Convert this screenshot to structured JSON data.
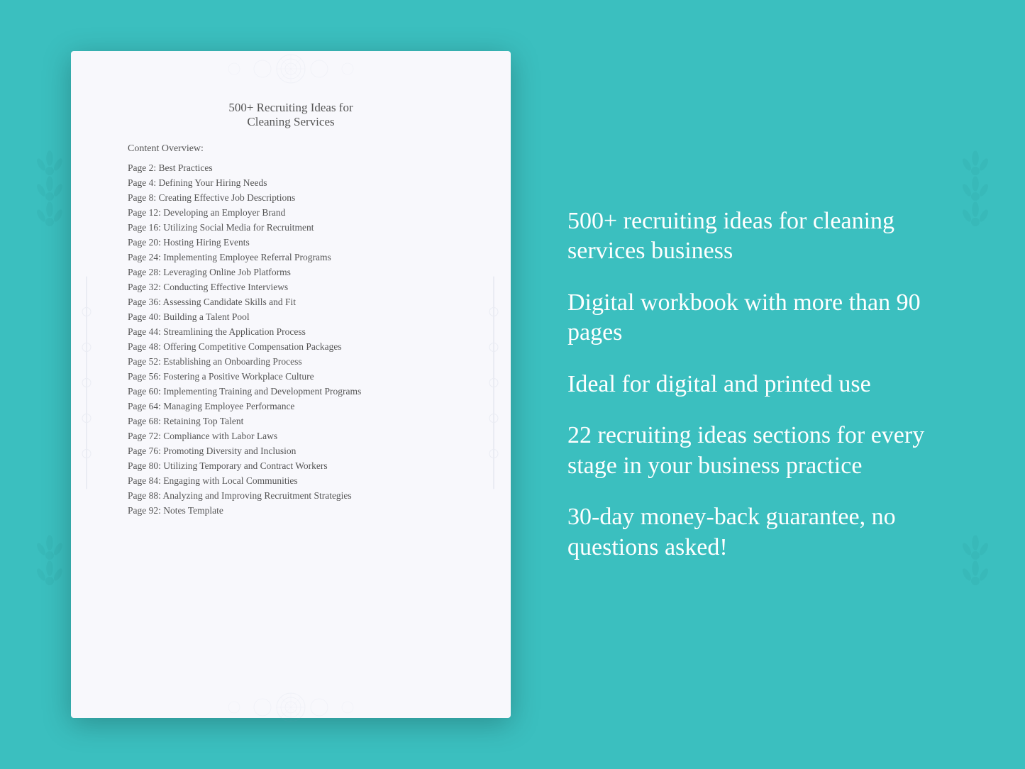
{
  "background": {
    "color": "#3bbfbf"
  },
  "document": {
    "title_line1": "500+ Recruiting Ideas for",
    "title_line2": "Cleaning Services",
    "content_overview_label": "Content Overview:",
    "toc_items": [
      {
        "page": "Page  2:",
        "title": "Best Practices"
      },
      {
        "page": "Page  4:",
        "title": "Defining Your Hiring Needs"
      },
      {
        "page": "Page  8:",
        "title": "Creating Effective Job Descriptions"
      },
      {
        "page": "Page 12:",
        "title": "Developing an Employer Brand"
      },
      {
        "page": "Page 16:",
        "title": "Utilizing Social Media for Recruitment"
      },
      {
        "page": "Page 20:",
        "title": "Hosting Hiring Events"
      },
      {
        "page": "Page 24:",
        "title": "Implementing Employee Referral Programs"
      },
      {
        "page": "Page 28:",
        "title": "Leveraging Online Job Platforms"
      },
      {
        "page": "Page 32:",
        "title": "Conducting Effective Interviews"
      },
      {
        "page": "Page 36:",
        "title": "Assessing Candidate Skills and Fit"
      },
      {
        "page": "Page 40:",
        "title": "Building a Talent Pool"
      },
      {
        "page": "Page 44:",
        "title": "Streamlining the Application Process"
      },
      {
        "page": "Page 48:",
        "title": "Offering Competitive Compensation Packages"
      },
      {
        "page": "Page 52:",
        "title": "Establishing an Onboarding Process"
      },
      {
        "page": "Page 56:",
        "title": "Fostering a Positive Workplace Culture"
      },
      {
        "page": "Page 60:",
        "title": "Implementing Training and Development Programs"
      },
      {
        "page": "Page 64:",
        "title": "Managing Employee Performance"
      },
      {
        "page": "Page 68:",
        "title": "Retaining Top Talent"
      },
      {
        "page": "Page 72:",
        "title": "Compliance with Labor Laws"
      },
      {
        "page": "Page 76:",
        "title": "Promoting Diversity and Inclusion"
      },
      {
        "page": "Page 80:",
        "title": "Utilizing Temporary and Contract Workers"
      },
      {
        "page": "Page 84:",
        "title": "Engaging with Local Communities"
      },
      {
        "page": "Page 88:",
        "title": "Analyzing and Improving Recruitment Strategies"
      },
      {
        "page": "Page 92:",
        "title": "Notes Template"
      }
    ]
  },
  "features": [
    "500+ recruiting ideas for cleaning services business",
    "Digital workbook with more than 90 pages",
    "Ideal for digital and printed use",
    "22 recruiting ideas sections for every stage in your business practice",
    "30-day money-back guarantee, no questions asked!"
  ]
}
